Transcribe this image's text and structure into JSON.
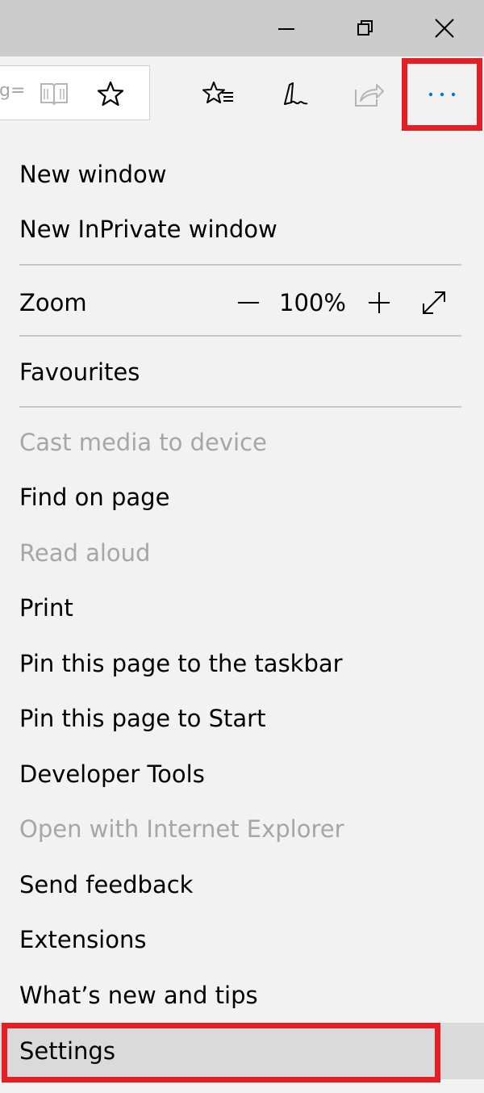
{
  "window": {
    "controls": [
      "minimize-icon",
      "restore-icon",
      "close-icon"
    ]
  },
  "address_bar": {
    "text": "g="
  },
  "toolbar": {
    "icons": [
      "reading-view-icon",
      "favorite-star-icon",
      "favorites-hub-icon",
      "web-note-icon",
      "share-icon",
      "more-icon"
    ],
    "accent_color": "#0078d7"
  },
  "menu": {
    "new_window": "New window",
    "new_inprivate": "New InPrivate window",
    "zoom": {
      "label": "Zoom",
      "value": "100%"
    },
    "favourites": "Favourites",
    "cast": "Cast media to device",
    "find": "Find on page",
    "read_aloud": "Read aloud",
    "print": "Print",
    "pin_taskbar": "Pin this page to the taskbar",
    "pin_start": "Pin this page to Start",
    "dev_tools": "Developer Tools",
    "open_ie": "Open with Internet Explorer",
    "feedback": "Send feedback",
    "extensions": "Extensions",
    "whats_new": "What’s new and tips",
    "settings": "Settings"
  },
  "colors": {
    "highlight": "#e31e24",
    "disabled_text": "#a6a6a6",
    "menu_bg": "#f2f2f2",
    "titlebar_bg": "#cccccc"
  }
}
